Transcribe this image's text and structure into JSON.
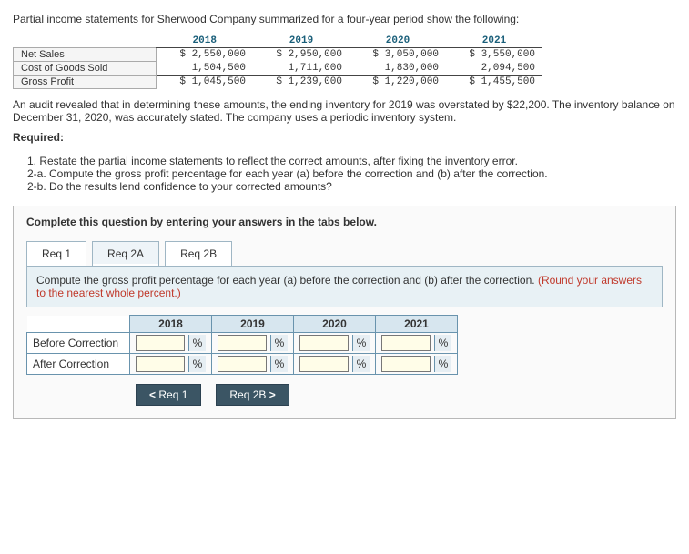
{
  "intro": "Partial income statements for Sherwood Company summarized for a four-year period show the following:",
  "fin": {
    "years": [
      "2018",
      "2019",
      "2020",
      "2021"
    ],
    "rows": [
      {
        "label": "Net Sales",
        "vals": [
          "$ 2,550,000",
          "$ 2,950,000",
          "$ 3,050,000",
          "$ 3,550,000"
        ]
      },
      {
        "label": "Cost of Goods Sold",
        "vals": [
          "1,504,500",
          "1,711,000",
          "1,830,000",
          "2,094,500"
        ]
      },
      {
        "label": "Gross Profit",
        "vals": [
          "$ 1,045,500",
          "$ 1,239,000",
          "$ 1,220,000",
          "$ 1,455,500"
        ]
      }
    ]
  },
  "audit": "An audit revealed that in determining these amounts, the ending inventory for 2019 was overstated by $22,200. The inventory balance on December 31, 2020, was accurately stated. The company uses a periodic inventory system.",
  "required_hdr": "Required:",
  "required_lines": [
    "1. Restate the partial income statements to reflect the correct amounts, after fixing the inventory error.",
    "2-a. Compute the gross profit percentage for each year (a) before the correction and (b) after the correction.",
    "2-b. Do the results lend confidence to your corrected amounts?"
  ],
  "panel_note": "Complete this question by entering your answers in the tabs below.",
  "tabs": {
    "r1": "Req 1",
    "r2a": "Req 2A",
    "r2b": "Req 2B"
  },
  "instr_main": "Compute the gross profit percentage for each year (a) before the correction and (b) after the correction. ",
  "instr_round": "(Round your answers to the nearest whole percent.)",
  "ans": {
    "cols": [
      "2018",
      "2019",
      "2020",
      "2021"
    ],
    "rows": [
      "Before Correction",
      "After Correction"
    ],
    "unit": "%"
  },
  "nav": {
    "prev": "Req 1",
    "next": "Req 2B"
  },
  "chart_data": {
    "type": "table",
    "title": "Partial Income Statements — Sherwood Company",
    "categories": [
      "2018",
      "2019",
      "2020",
      "2021"
    ],
    "series": [
      {
        "name": "Net Sales",
        "values": [
          2550000,
          2950000,
          3050000,
          3550000
        ]
      },
      {
        "name": "Cost of Goods Sold",
        "values": [
          1504500,
          1711000,
          1830000,
          2094500
        ]
      },
      {
        "name": "Gross Profit",
        "values": [
          1045500,
          1239000,
          1220000,
          1455500
        ]
      }
    ]
  }
}
